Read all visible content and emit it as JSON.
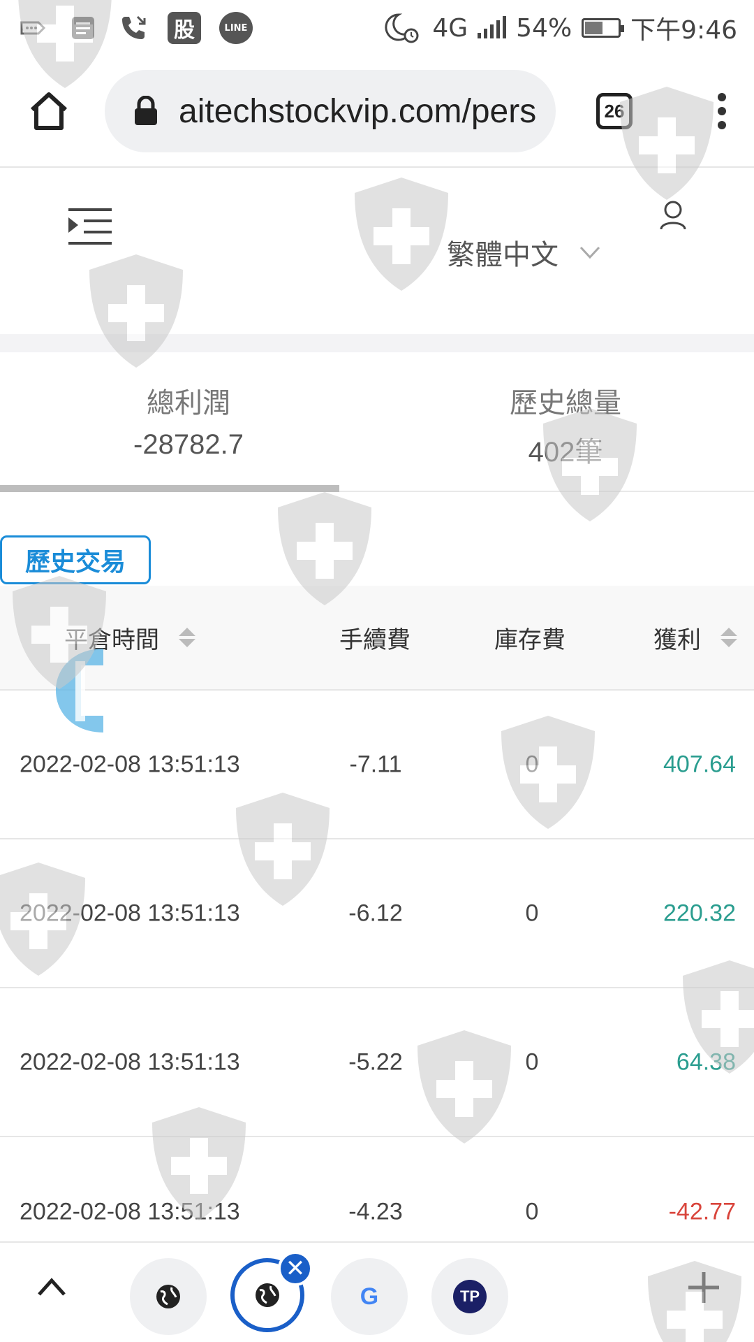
{
  "status_bar": {
    "stock_app_label": "股",
    "line_app_label": "LINE",
    "network": "4G",
    "battery": "54%",
    "battery_level": 0.54,
    "time": "下午9:46"
  },
  "browser": {
    "url": "aitechstockvip.com/pers",
    "tab_count": "26"
  },
  "header": {
    "language": "繁體中文"
  },
  "stats": {
    "total_profit_label": "總利潤",
    "total_profit_value": "-28782.7",
    "history_volume_label": "歷史總量",
    "history_volume_value": "402筆"
  },
  "history": {
    "tab_label": "歷史交易",
    "columns": {
      "close_time": "平倉時間",
      "fee": "手續費",
      "storage": "庫存費",
      "profit": "獲利"
    },
    "rows": [
      {
        "close_time": "2022-02-08 13:51:13",
        "fee": "-7.11",
        "storage": "0",
        "profit": "407.64",
        "profit_color": "#2a9d8f"
      },
      {
        "close_time": "2022-02-08 13:51:13",
        "fee": "-6.12",
        "storage": "0",
        "profit": "220.32",
        "profit_color": "#2a9d8f"
      },
      {
        "close_time": "2022-02-08 13:51:13",
        "fee": "-5.22",
        "storage": "0",
        "profit": "64.38",
        "profit_color": "#2a9d8f"
      },
      {
        "close_time": "2022-02-08 13:51:13",
        "fee": "-4.23",
        "storage": "0",
        "profit": "-42.77",
        "profit_color": "#d9453c"
      }
    ]
  },
  "bottom_bar": {
    "google_label": "G",
    "tp_label": "TP"
  },
  "colors": {
    "accent": "#1a8cd8",
    "positive": "#2a9d8f",
    "negative": "#d9453c",
    "active_tab": "#1a5fc8"
  }
}
